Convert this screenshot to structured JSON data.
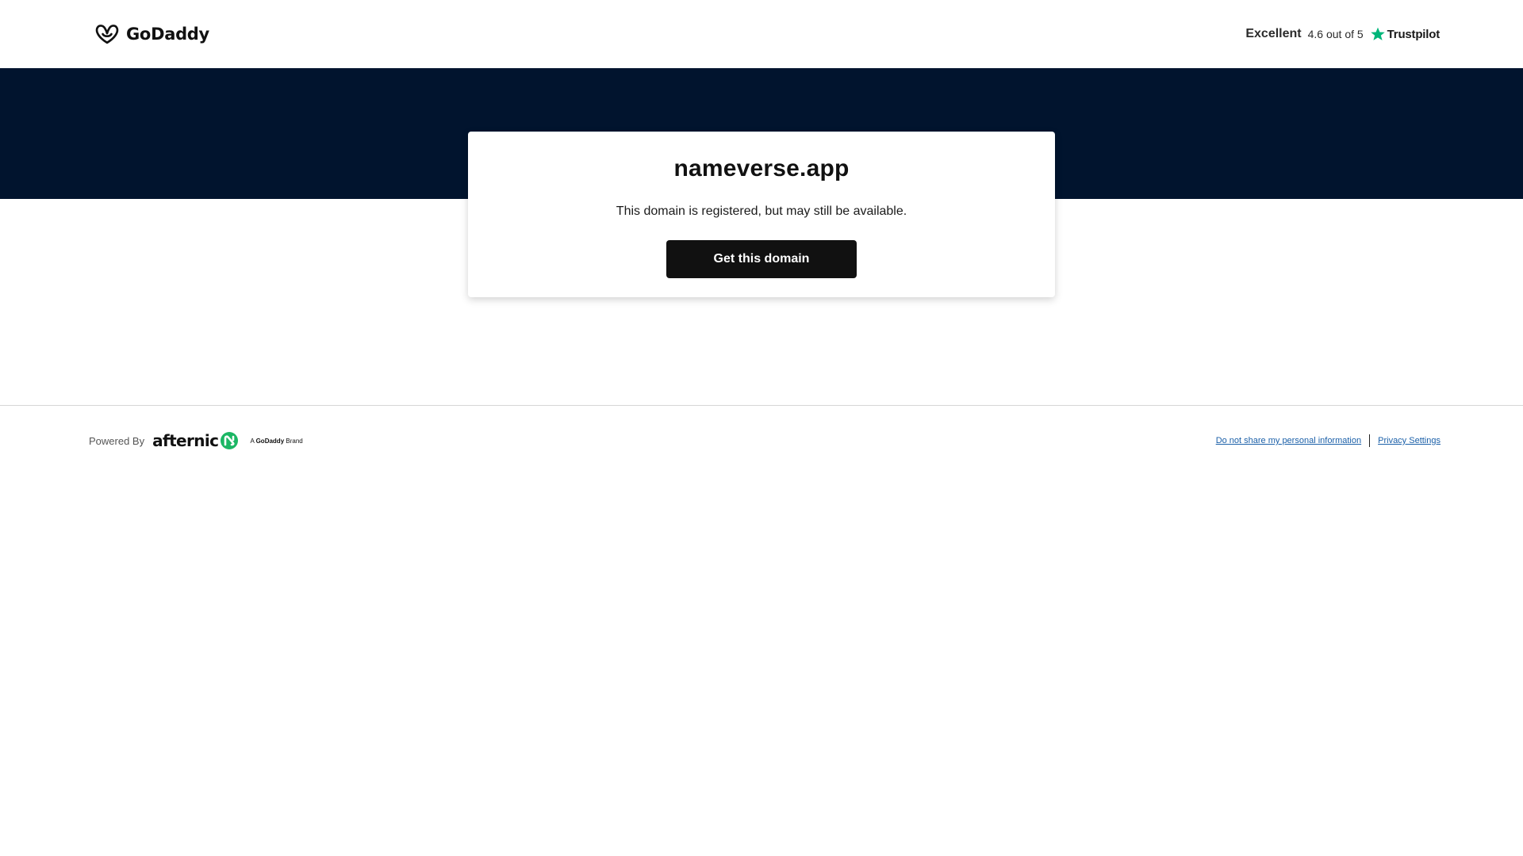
{
  "header": {
    "logo_text": "GoDaddy",
    "rating_label": "Excellent",
    "rating_score": "4.6 out of 5",
    "trustpilot_text": "Trustpilot",
    "trustpilot_star_color": "#00b67a"
  },
  "colors": {
    "hero_band": "#01142e",
    "button_bg": "#111111",
    "afternic_green": "#1bb664",
    "link_color": "#1a5fa8"
  },
  "card": {
    "domain_name": "nameverse.app",
    "subtitle": "This domain is registered, but may still be available.",
    "button_label": "Get this domain"
  },
  "footer": {
    "powered_by": "Powered By",
    "afternic_text": "afternic",
    "brand_prefix": "A",
    "brand_name": "GoDaddy",
    "brand_suffix": "Brand",
    "links": {
      "do_not_share": "Do not share my personal information",
      "privacy_settings": "Privacy Settings"
    }
  },
  "icons": {
    "logo": "godaddy-logo-icon",
    "trustpilot": "trustpilot-star-icon",
    "afternic": "afternic-mark-icon"
  }
}
